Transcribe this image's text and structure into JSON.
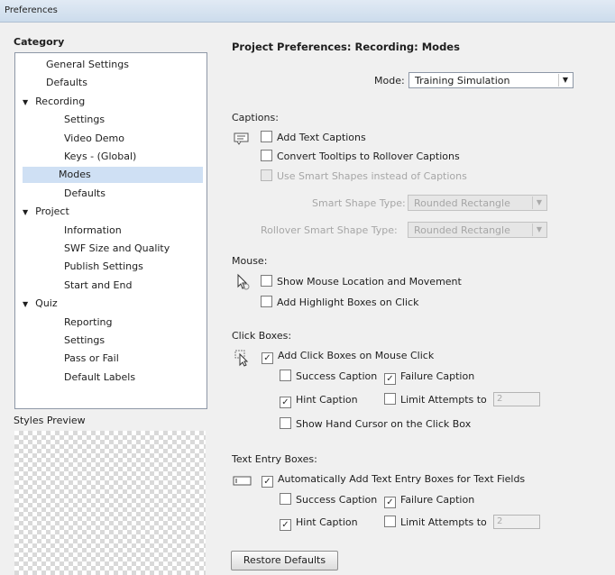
{
  "window": {
    "title": "Preferences"
  },
  "category": {
    "label": "Category",
    "items": [
      {
        "label": "General Settings",
        "level": 1,
        "selected": false,
        "expandable": false
      },
      {
        "label": "Defaults",
        "level": 1,
        "selected": false,
        "expandable": false
      },
      {
        "label": "Recording",
        "level": 0,
        "selected": false,
        "expandable": true
      },
      {
        "label": "Settings",
        "level": 2,
        "selected": false,
        "expandable": false
      },
      {
        "label": "Video Demo",
        "level": 2,
        "selected": false,
        "expandable": false
      },
      {
        "label": "Keys - (Global)",
        "level": 2,
        "selected": false,
        "expandable": false
      },
      {
        "label": "Modes",
        "level": 2,
        "selected": true,
        "expandable": false
      },
      {
        "label": "Defaults",
        "level": 2,
        "selected": false,
        "expandable": false
      },
      {
        "label": "Project",
        "level": 0,
        "selected": false,
        "expandable": true
      },
      {
        "label": "Information",
        "level": 2,
        "selected": false,
        "expandable": false
      },
      {
        "label": "SWF Size and Quality",
        "level": 2,
        "selected": false,
        "expandable": false
      },
      {
        "label": "Publish Settings",
        "level": 2,
        "selected": false,
        "expandable": false
      },
      {
        "label": "Start and End",
        "level": 2,
        "selected": false,
        "expandable": false
      },
      {
        "label": "Quiz",
        "level": 0,
        "selected": false,
        "expandable": true
      },
      {
        "label": "Reporting",
        "level": 2,
        "selected": false,
        "expandable": false
      },
      {
        "label": "Settings",
        "level": 2,
        "selected": false,
        "expandable": false
      },
      {
        "label": "Pass or Fail",
        "level": 2,
        "selected": false,
        "expandable": false
      },
      {
        "label": "Default Labels",
        "level": 2,
        "selected": false,
        "expandable": false
      }
    ],
    "expand_glyph": "▼"
  },
  "styles_preview": {
    "label": "Styles Preview"
  },
  "panel": {
    "title": "Project Preferences: Recording: Modes",
    "mode_label": "Mode:",
    "mode_value": "Training Simulation"
  },
  "captions": {
    "header": "Captions:",
    "add_text_captions": "Add Text Captions",
    "convert_tooltips": "Convert Tooltips to Rollover Captions",
    "smart_shapes": "Use Smart Shapes instead of Captions",
    "smart_shape_type_label": "Smart Shape Type:",
    "smart_shape_type_value": "Rounded Rectangle",
    "rollover_shape_type_label": "Rollover Smart Shape Type:",
    "rollover_shape_type_value": "Rounded Rectangle"
  },
  "mouse": {
    "header": "Mouse:",
    "show_mouse": "Show Mouse Location and Movement",
    "highlight_boxes": "Add Highlight Boxes on Click"
  },
  "click_boxes": {
    "header": "Click Boxes:",
    "add_click_boxes": "Add Click Boxes on Mouse Click",
    "success_caption": "Success Caption",
    "failure_caption": "Failure Caption",
    "hint_caption": "Hint Caption",
    "limit_attempts": "Limit Attempts to",
    "limit_value": "2",
    "hand_cursor": "Show Hand Cursor on the Click Box"
  },
  "text_entry": {
    "header": "Text Entry Boxes:",
    "auto_add": "Automatically Add Text Entry Boxes for Text Fields",
    "success_caption": "Success Caption",
    "failure_caption": "Failure Caption",
    "hint_caption": "Hint Caption",
    "limit_attempts": "Limit Attempts to",
    "limit_value": "2"
  },
  "buttons": {
    "restore_defaults": "Restore Defaults"
  },
  "icons": {
    "captions": "caption-icon",
    "mouse": "mouse-pointer-icon",
    "click_boxes": "click-box-icon",
    "text_entry": "text-entry-icon",
    "check": "✓",
    "dropdown": "▼"
  },
  "colors": {
    "selection": "#cfe0f4",
    "title_bar": "#d6e3f0"
  }
}
